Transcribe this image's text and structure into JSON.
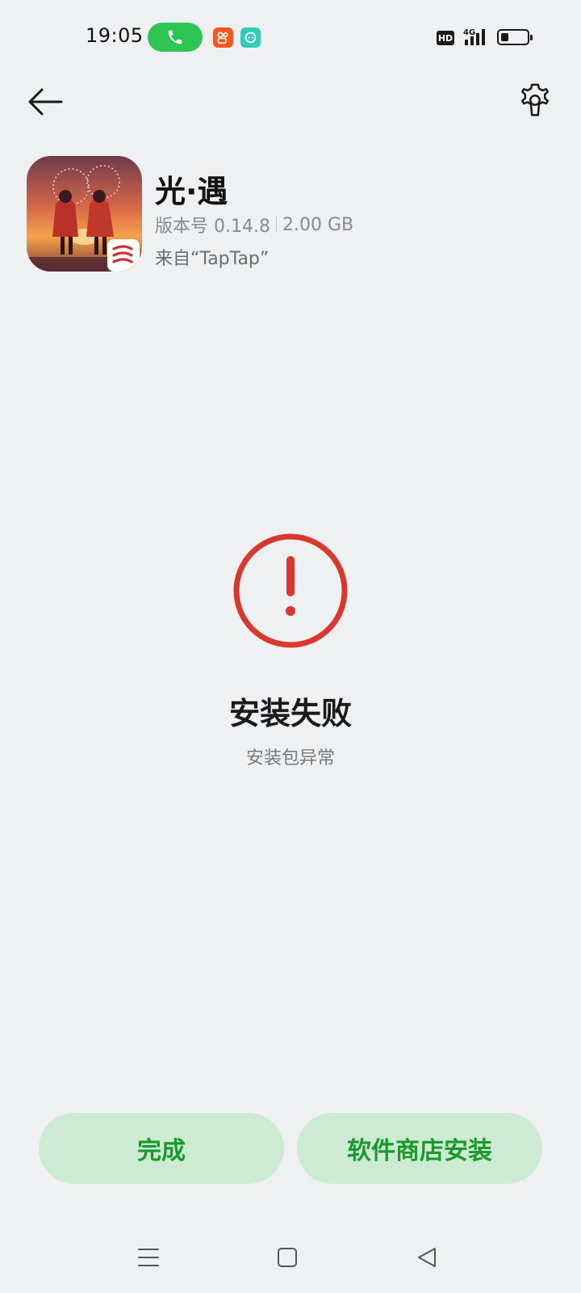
{
  "status_bar": {
    "time": "19:05",
    "network": "4G",
    "hd_label": "HD",
    "icons": [
      "phone-icon",
      "kuaishou-app-icon",
      "chat-app-icon",
      "hd-icon",
      "signal-icon",
      "battery-icon"
    ]
  },
  "header": {
    "back_icon": "arrow-left-icon",
    "settings_icon": "gear-icon"
  },
  "app": {
    "name": "光·遇",
    "version": "版本号 0.14.8",
    "size": "2.00 GB",
    "source": "来自“TapTap”"
  },
  "status": {
    "icon": "exclamation-circle-icon",
    "title": "安装失败",
    "subtitle": "安装包异常",
    "color": "#d9382f"
  },
  "buttons": {
    "done_label": "完成",
    "store_install_label": "软件商店安装",
    "accent": "#1a9a2c",
    "background": "#cdebd2"
  },
  "nav_bar": {
    "icons": [
      "menu-icon",
      "home-square-icon",
      "back-triangle-icon"
    ]
  }
}
